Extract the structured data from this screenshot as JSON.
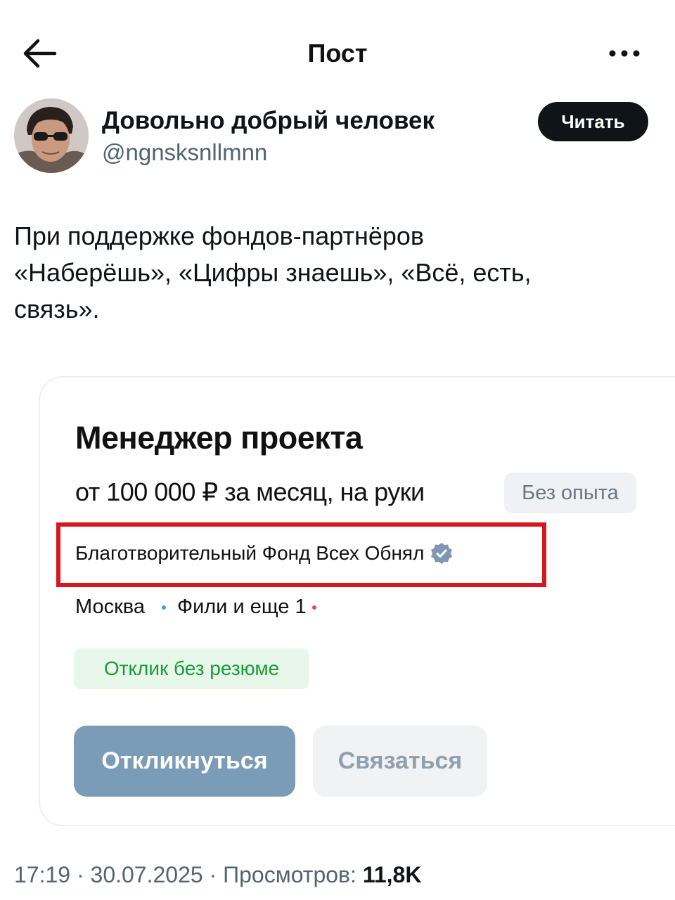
{
  "header": {
    "title": "Пост",
    "back_icon": "arrow-left-icon",
    "more_icon": "more-horizontal-icon"
  },
  "author": {
    "name": "Довольно добрый человек",
    "handle": "@ngnsksnllmnn",
    "follow_label": "Читать"
  },
  "post": {
    "text_lines": [
      "При поддержке фондов-партнёров",
      "«Наберёшь», «Цифры знаешь», «Всё, есть,",
      "связь»."
    ]
  },
  "vacancy": {
    "title": "Менеджер проекта",
    "salary": "от 100 000 ₽ за месяц, на руки",
    "experience_badge": "Без опыта",
    "company": "Благотворительный Фонд Всех Обнял",
    "city": "Москва",
    "metro": "Фили и еще 1",
    "resume_badge": "Отклик без резюме",
    "apply_label": "Откликнуться",
    "contact_label": "Связаться",
    "highlight_color": "#d7171f",
    "accent_color": "#7b9cb6"
  },
  "meta": {
    "time": "17:19",
    "sep1": " · ",
    "date": "30.07.2025",
    "sep2": " · ",
    "views_label": "Просмотров: ",
    "views_value": "11,8K"
  }
}
